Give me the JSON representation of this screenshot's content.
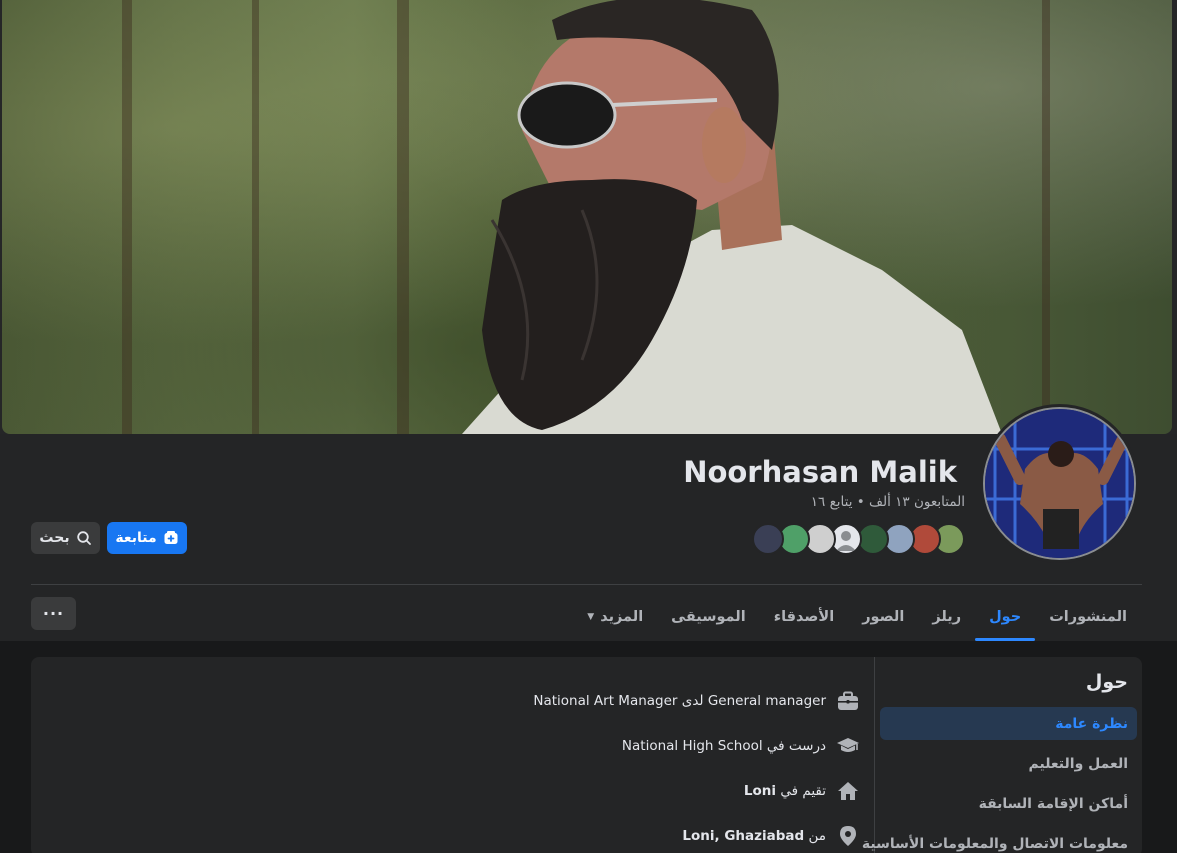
{
  "profile": {
    "name": "Noorhasan Malik",
    "stats": "المتابعون ١٣ ألف • يتابع ١٦"
  },
  "actions": {
    "follow_label": "متابعة",
    "search_label": "بحث",
    "more_label": "···"
  },
  "tabs": [
    {
      "label": "المنشورات",
      "active": false
    },
    {
      "label": "حول",
      "active": true
    },
    {
      "label": "ريلز",
      "active": false
    },
    {
      "label": "الصور",
      "active": false
    },
    {
      "label": "الأصدقاء",
      "active": false
    },
    {
      "label": "الموسيقى",
      "active": false
    },
    {
      "label": "المزيد",
      "active": false
    }
  ],
  "about": {
    "title": "حول",
    "sidebar": [
      {
        "label": "نظرة عامة",
        "active": true
      },
      {
        "label": "العمل والتعليم",
        "active": false
      },
      {
        "label": "أماكن الإقامة السابقة",
        "active": false
      },
      {
        "label": "معلومات الاتصال والمعلومات الأساسية",
        "active": false
      }
    ],
    "items": [
      {
        "icon": "briefcase-icon",
        "prefix": "",
        "text": "General manager لدى National Art Manager"
      },
      {
        "icon": "graduation-cap-icon",
        "prefix": "درست في",
        "text": "National High School"
      },
      {
        "icon": "home-icon",
        "prefix": "تقيم في",
        "bold": "Loni"
      },
      {
        "icon": "location-pin-icon",
        "prefix": "من",
        "bold": "Loni, Ghaziabad"
      }
    ]
  },
  "colors": {
    "accent": "#1877f2",
    "active_tab": "#2d88ff",
    "surface": "#242526",
    "background": "#18191a"
  }
}
